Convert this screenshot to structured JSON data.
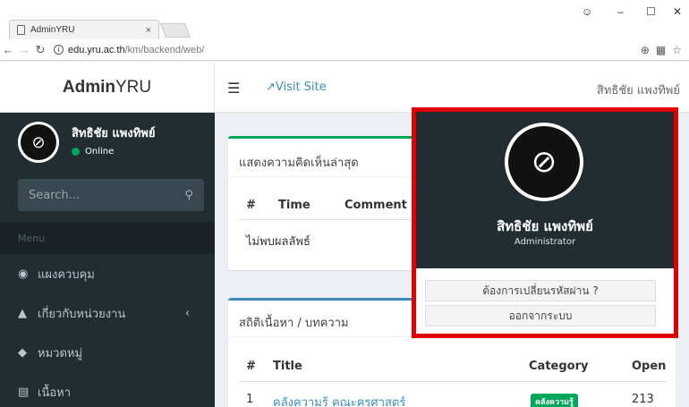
{
  "browser": {
    "tab_title": "AdminYRU",
    "tab_close": "×",
    "url_host": "edu.yru.ac.th",
    "url_path": "/km/backend/web/",
    "window_controls": [
      "–",
      "☐",
      "✕"
    ],
    "profile_icon": "profile-icon"
  },
  "header": {
    "logo_bold": "Admin",
    "logo_rest": "YRU",
    "visit_site": "Visit Site",
    "user_name": "สิทธิชัย แพงทิพย์"
  },
  "sidebar": {
    "user_name": "สิทธิชัย แพงทิพย์",
    "status": "Online",
    "search_placeholder": "Search...",
    "menu_header": "Menu",
    "items": [
      {
        "label": "แผงควบคุม",
        "icon": "dashboard-icon"
      },
      {
        "label": "เกี่ยวกับหน่วยงาน",
        "icon": "bank-icon"
      },
      {
        "label": "หมวดหมู่",
        "icon": "tags-icon"
      },
      {
        "label": "เนื้อหา",
        "icon": "newspaper-icon"
      }
    ]
  },
  "comments_box": {
    "title": "แสดงความคิดเห็นล่าสุด",
    "columns": [
      "#",
      "Time",
      "Comment"
    ],
    "empty_text": "ไม่พบผลลัพธ์"
  },
  "stats_box": {
    "title": "สถิติเนื้อหา / บทความ",
    "columns": [
      "#",
      "Title",
      "Category",
      "Open"
    ],
    "rows": [
      {
        "num": "1",
        "title": "คลังความรู้ คณะครุศาสตร์",
        "category": "คลังความรู้",
        "open": "213"
      }
    ]
  },
  "user_dropdown": {
    "name": "สิทธิชัย แพงทิพย์",
    "role": "Administrator",
    "change_password": "ต้องการเปลี่ยนรหัสผ่าน ?",
    "logout": "ออกจากระบบ"
  },
  "colors": {
    "sidebar_bg": "#222d32",
    "accent_blue": "#3c8dbc",
    "accent_green": "#00a65a",
    "highlight_red": "#e00000"
  }
}
